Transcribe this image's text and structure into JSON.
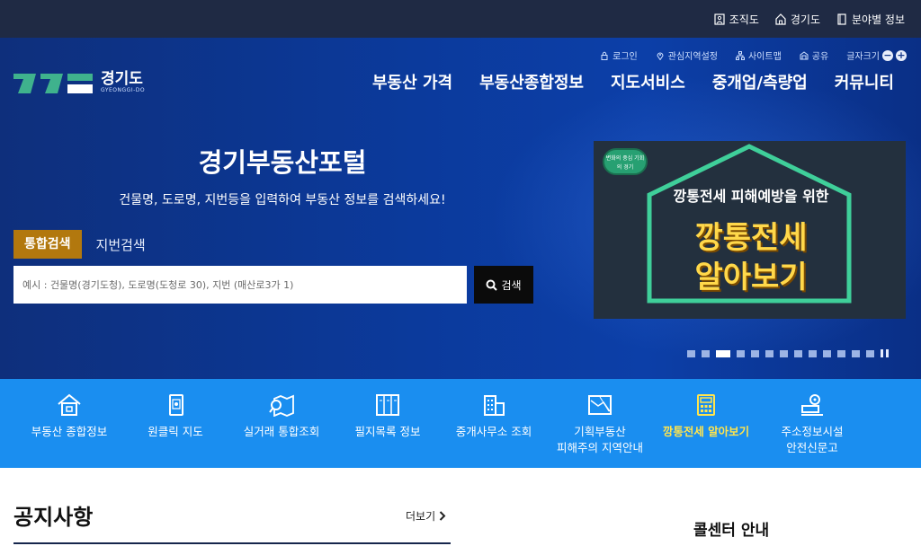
{
  "topbar": {
    "links": [
      {
        "label": "조직도",
        "icon": "org-chart-icon"
      },
      {
        "label": "경기도",
        "icon": "home-icon"
      },
      {
        "label": "분야별 정보",
        "icon": "document-icon"
      }
    ]
  },
  "util": {
    "login": "로그인",
    "interest": "관심지역설정",
    "sitemap": "사이트맵",
    "share": "공유",
    "fontsize": "글자크기",
    "zoom_out": "−",
    "zoom_in": "+"
  },
  "logo": {
    "name": "경기도",
    "sub": "GYEONGGI-DO"
  },
  "gnb": [
    "부동산 가격",
    "부동산종합정보",
    "지도서비스",
    "중개업/측량업",
    "커뮤니티"
  ],
  "hero": {
    "title": "경기부동산포털",
    "desc": "건물명, 도로명, 지번등을 입력하여 부동산 정보를 검색하세요!"
  },
  "search": {
    "tab_active": "통합검색",
    "tab_other": "지번검색",
    "placeholder": "예시 : 건물명(경기도청), 도로명(도청로 30), 지번 (매산로3가 1)",
    "button": "검색"
  },
  "banner": {
    "badge": "변화의 중심 기회의 경기",
    "line1": "깡통전세 피해예방을 위한",
    "line2": "깡통전세",
    "line3": "알아보기"
  },
  "quick": [
    {
      "label": "부동산 종합정보",
      "icon": "house-icon"
    },
    {
      "label": "원클릭 지도",
      "icon": "mobile-map-icon"
    },
    {
      "label": "실거래 통합조회",
      "icon": "map-search-icon"
    },
    {
      "label": "필지목록 정보",
      "icon": "book-list-icon"
    },
    {
      "label": "중개사무소 조회",
      "icon": "building-icon"
    },
    {
      "label": "기획부동산\n피해주의 지역안내",
      "icon": "map-warning-icon"
    },
    {
      "label": "깡통전세 알아보기",
      "icon": "calculator-icon"
    },
    {
      "label": "주소정보시설\n안전신문고",
      "icon": "location-board-icon"
    }
  ],
  "notice": {
    "title": "공지사항",
    "more": "더보기"
  },
  "callcenter": {
    "title": "콜센터 안내"
  },
  "colors": {
    "topbar": "#1f2a44",
    "hero": "#0b3a9c",
    "quick": "#1a8ef0",
    "accent": "#b2780e",
    "highlight": "#ffe44d"
  }
}
